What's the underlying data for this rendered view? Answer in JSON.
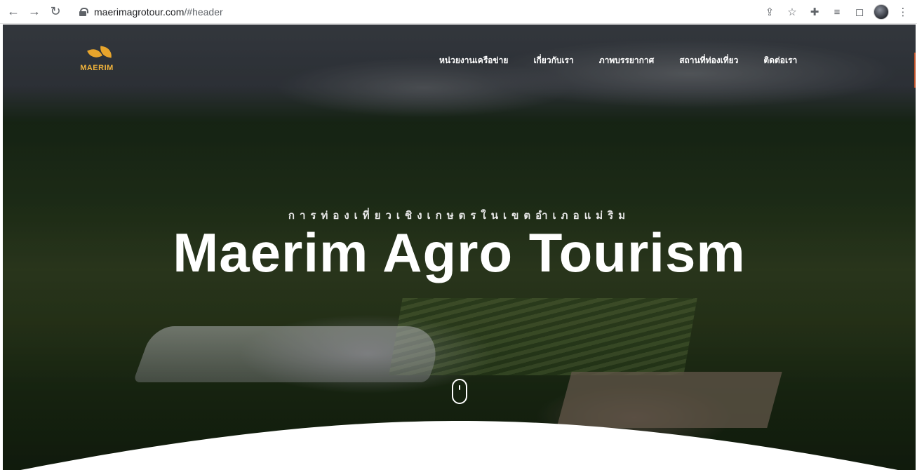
{
  "browser": {
    "url_host": "maerimagrotour.com",
    "url_path": "/#header",
    "icons": [
      "back-icon",
      "forward-icon",
      "reload-icon",
      "lock-icon",
      "share-icon",
      "bookmark-star-icon",
      "extensions-icon",
      "reading-list-icon",
      "side-panel-icon",
      "profile-avatar",
      "more-menu-icon"
    ]
  },
  "site": {
    "logo_text": "MAERIM",
    "brand_color": "#e8a52c",
    "nav": [
      {
        "label": "หน่วยงานเครือข่าย"
      },
      {
        "label": "เกี่ยวกับเรา"
      },
      {
        "label": "ภาพบรรยากาศ"
      },
      {
        "label": "สถานที่ท่องเที่ยว"
      },
      {
        "label": "ติดต่อเรา"
      }
    ]
  },
  "hero": {
    "subtitle": "การท่องเที่ยวเชิงเกษตรในเขตอำเภอแม่ริม",
    "title": "Maerim Agro Tourism"
  }
}
